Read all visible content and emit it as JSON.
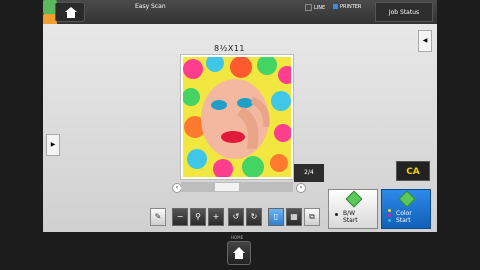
{
  "topbar": {
    "easy_scan_label": "Easy Scan",
    "line_label": "LINE",
    "printer_label": "PRINTER",
    "job_status_label": "Job Status"
  },
  "preview": {
    "paper_size": "8½X11",
    "page_counter": "2/4"
  },
  "actions": {
    "clear_all_label": "CA",
    "bw_line1": "B/W",
    "bw_line2": "Start",
    "color_line1": "Color",
    "color_line2": "Start"
  },
  "footer": {
    "home_label": "HOME"
  },
  "icons": {
    "home": "home-icon",
    "copy": "copy-icon",
    "scan": "scan-icon",
    "zoom_out": "minus-icon",
    "zoom": "magnifier-icon",
    "zoom_in": "plus-icon",
    "rotate_left": "rotate-left-icon",
    "rotate_right": "rotate-right-icon"
  },
  "colors": {
    "accent_blue": "#2d8ae8",
    "start_green": "#5cc85c",
    "ca_yellow": "#f5d000"
  }
}
